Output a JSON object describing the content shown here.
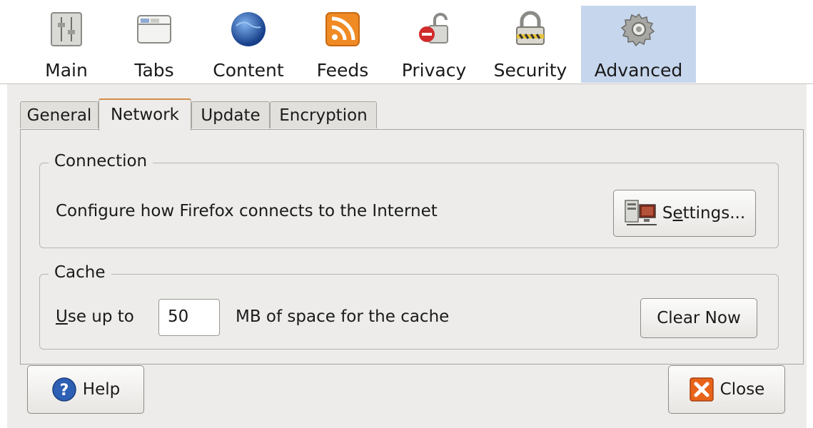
{
  "toolbar": {
    "items": [
      {
        "label": "Main",
        "icon": "main-icon"
      },
      {
        "label": "Tabs",
        "icon": "tabs-icon"
      },
      {
        "label": "Content",
        "icon": "globe-icon"
      },
      {
        "label": "Feeds",
        "icon": "rss-icon"
      },
      {
        "label": "Privacy",
        "icon": "privacy-lock-icon"
      },
      {
        "label": "Security",
        "icon": "padlock-icon"
      },
      {
        "label": "Advanced",
        "icon": "gear-icon"
      }
    ],
    "selected": "Advanced",
    "selected_color": "#c6d6ec"
  },
  "subtabs": {
    "items": [
      "General",
      "Network",
      "Update",
      "Encryption"
    ],
    "active": "Network",
    "active_accent": "#d38d49"
  },
  "connection": {
    "legend": "Connection",
    "description": "Configure how Firefox connects to the Internet",
    "settings_button": {
      "label_prefix": "S",
      "label_mnemonic": "e",
      "label_suffix": "ttings...",
      "icon": "network-settings-icon"
    }
  },
  "cache": {
    "legend": "Cache",
    "use_up_to_mnemonic": "U",
    "use_up_to_rest": "se up to",
    "value": "50",
    "units_text": "MB of space for the cache",
    "clear_button": "Clear Now"
  },
  "footer": {
    "help_button": "Help",
    "help_icon": "help-icon",
    "close_button": "Close",
    "close_icon": "close-icon"
  }
}
